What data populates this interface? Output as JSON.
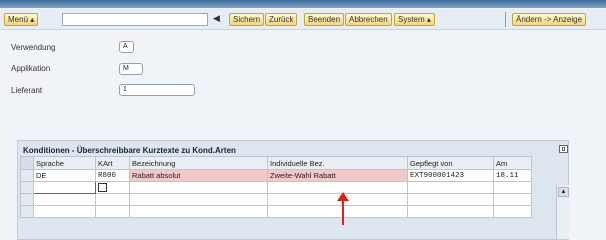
{
  "toolbar": {
    "menu_label": "Menü ▴",
    "command_value": "",
    "back_glyph": "◀",
    "buttons": [
      "Sichern",
      "Zurück",
      "Beenden",
      "Abbrechen",
      "System ▴",
      "Ändern -> Anzeige"
    ]
  },
  "form": {
    "verwendung": {
      "label": "Verwendung",
      "value": "A"
    },
    "applikation": {
      "label": "Applikation",
      "value": "M"
    },
    "lieferant": {
      "label": "Lieferant",
      "value": "1"
    }
  },
  "panel": {
    "title": "Konditionen - Überschreibbare Kurztexte zu Kond.Arten",
    "columns": [
      "Sprache",
      "KArt",
      "Bezeichnung",
      "Individuelle Bez.",
      "Gepflegt von",
      "Am"
    ],
    "rows": [
      [
        "DE",
        "R800",
        "Rabatt absolut",
        "Zweite-Wahl Rabatt",
        "EXT900001423",
        "18.11"
      ]
    ]
  },
  "colors": {
    "highlight": "#f2c9c9",
    "button_bg": "#f2d777",
    "arrow": "#e0201a"
  }
}
